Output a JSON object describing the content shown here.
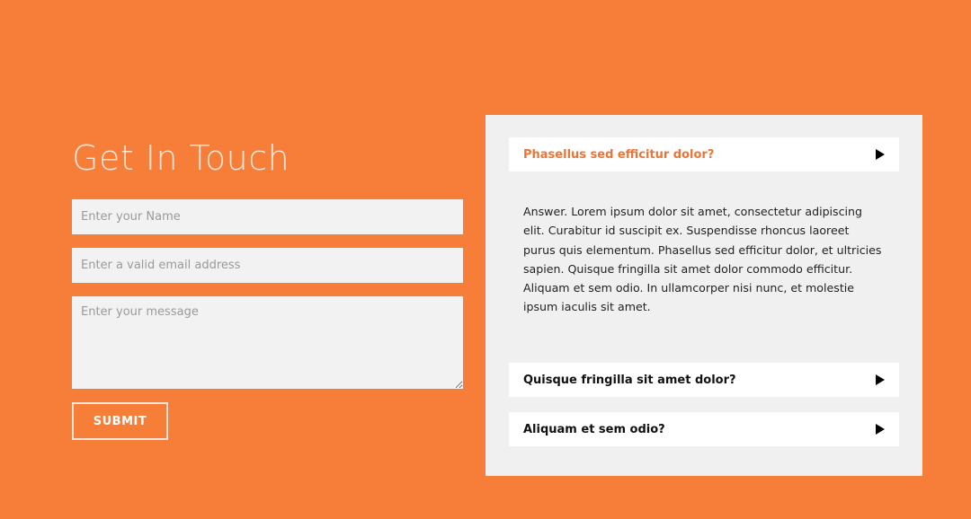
{
  "contact": {
    "title": "Get In Touch",
    "name_placeholder": "Enter your Name",
    "email_placeholder": "Enter a valid email address",
    "message_placeholder": "Enter your message",
    "submit_label": "SUBMIT"
  },
  "faq": {
    "items": [
      {
        "question": "Phasellus sed efficitur dolor?",
        "answer": "Answer. Lorem ipsum dolor sit amet, consectetur adipiscing elit. Curabitur id suscipit ex. Suspendisse rhoncus laoreet purus quis elementum. Phasellus sed efficitur dolor, et ultricies sapien. Quisque fringilla sit amet dolor commodo efficitur. Aliquam et sem odio. In ullamcorper nisi nunc, et molestie ipsum iaculis sit amet.",
        "expanded": true
      },
      {
        "question": "Quisque fringilla sit amet dolor?",
        "expanded": false
      },
      {
        "question": "Aliquam et sem odio?",
        "expanded": false
      }
    ]
  },
  "colors": {
    "background": "#F77E38",
    "panel": "#F0F0F0",
    "field": "#F2F2F2",
    "active_question": "#E8763A",
    "title": "#FBE3D5"
  },
  "icons": {
    "faq_toggle": "triangle-right-icon"
  }
}
